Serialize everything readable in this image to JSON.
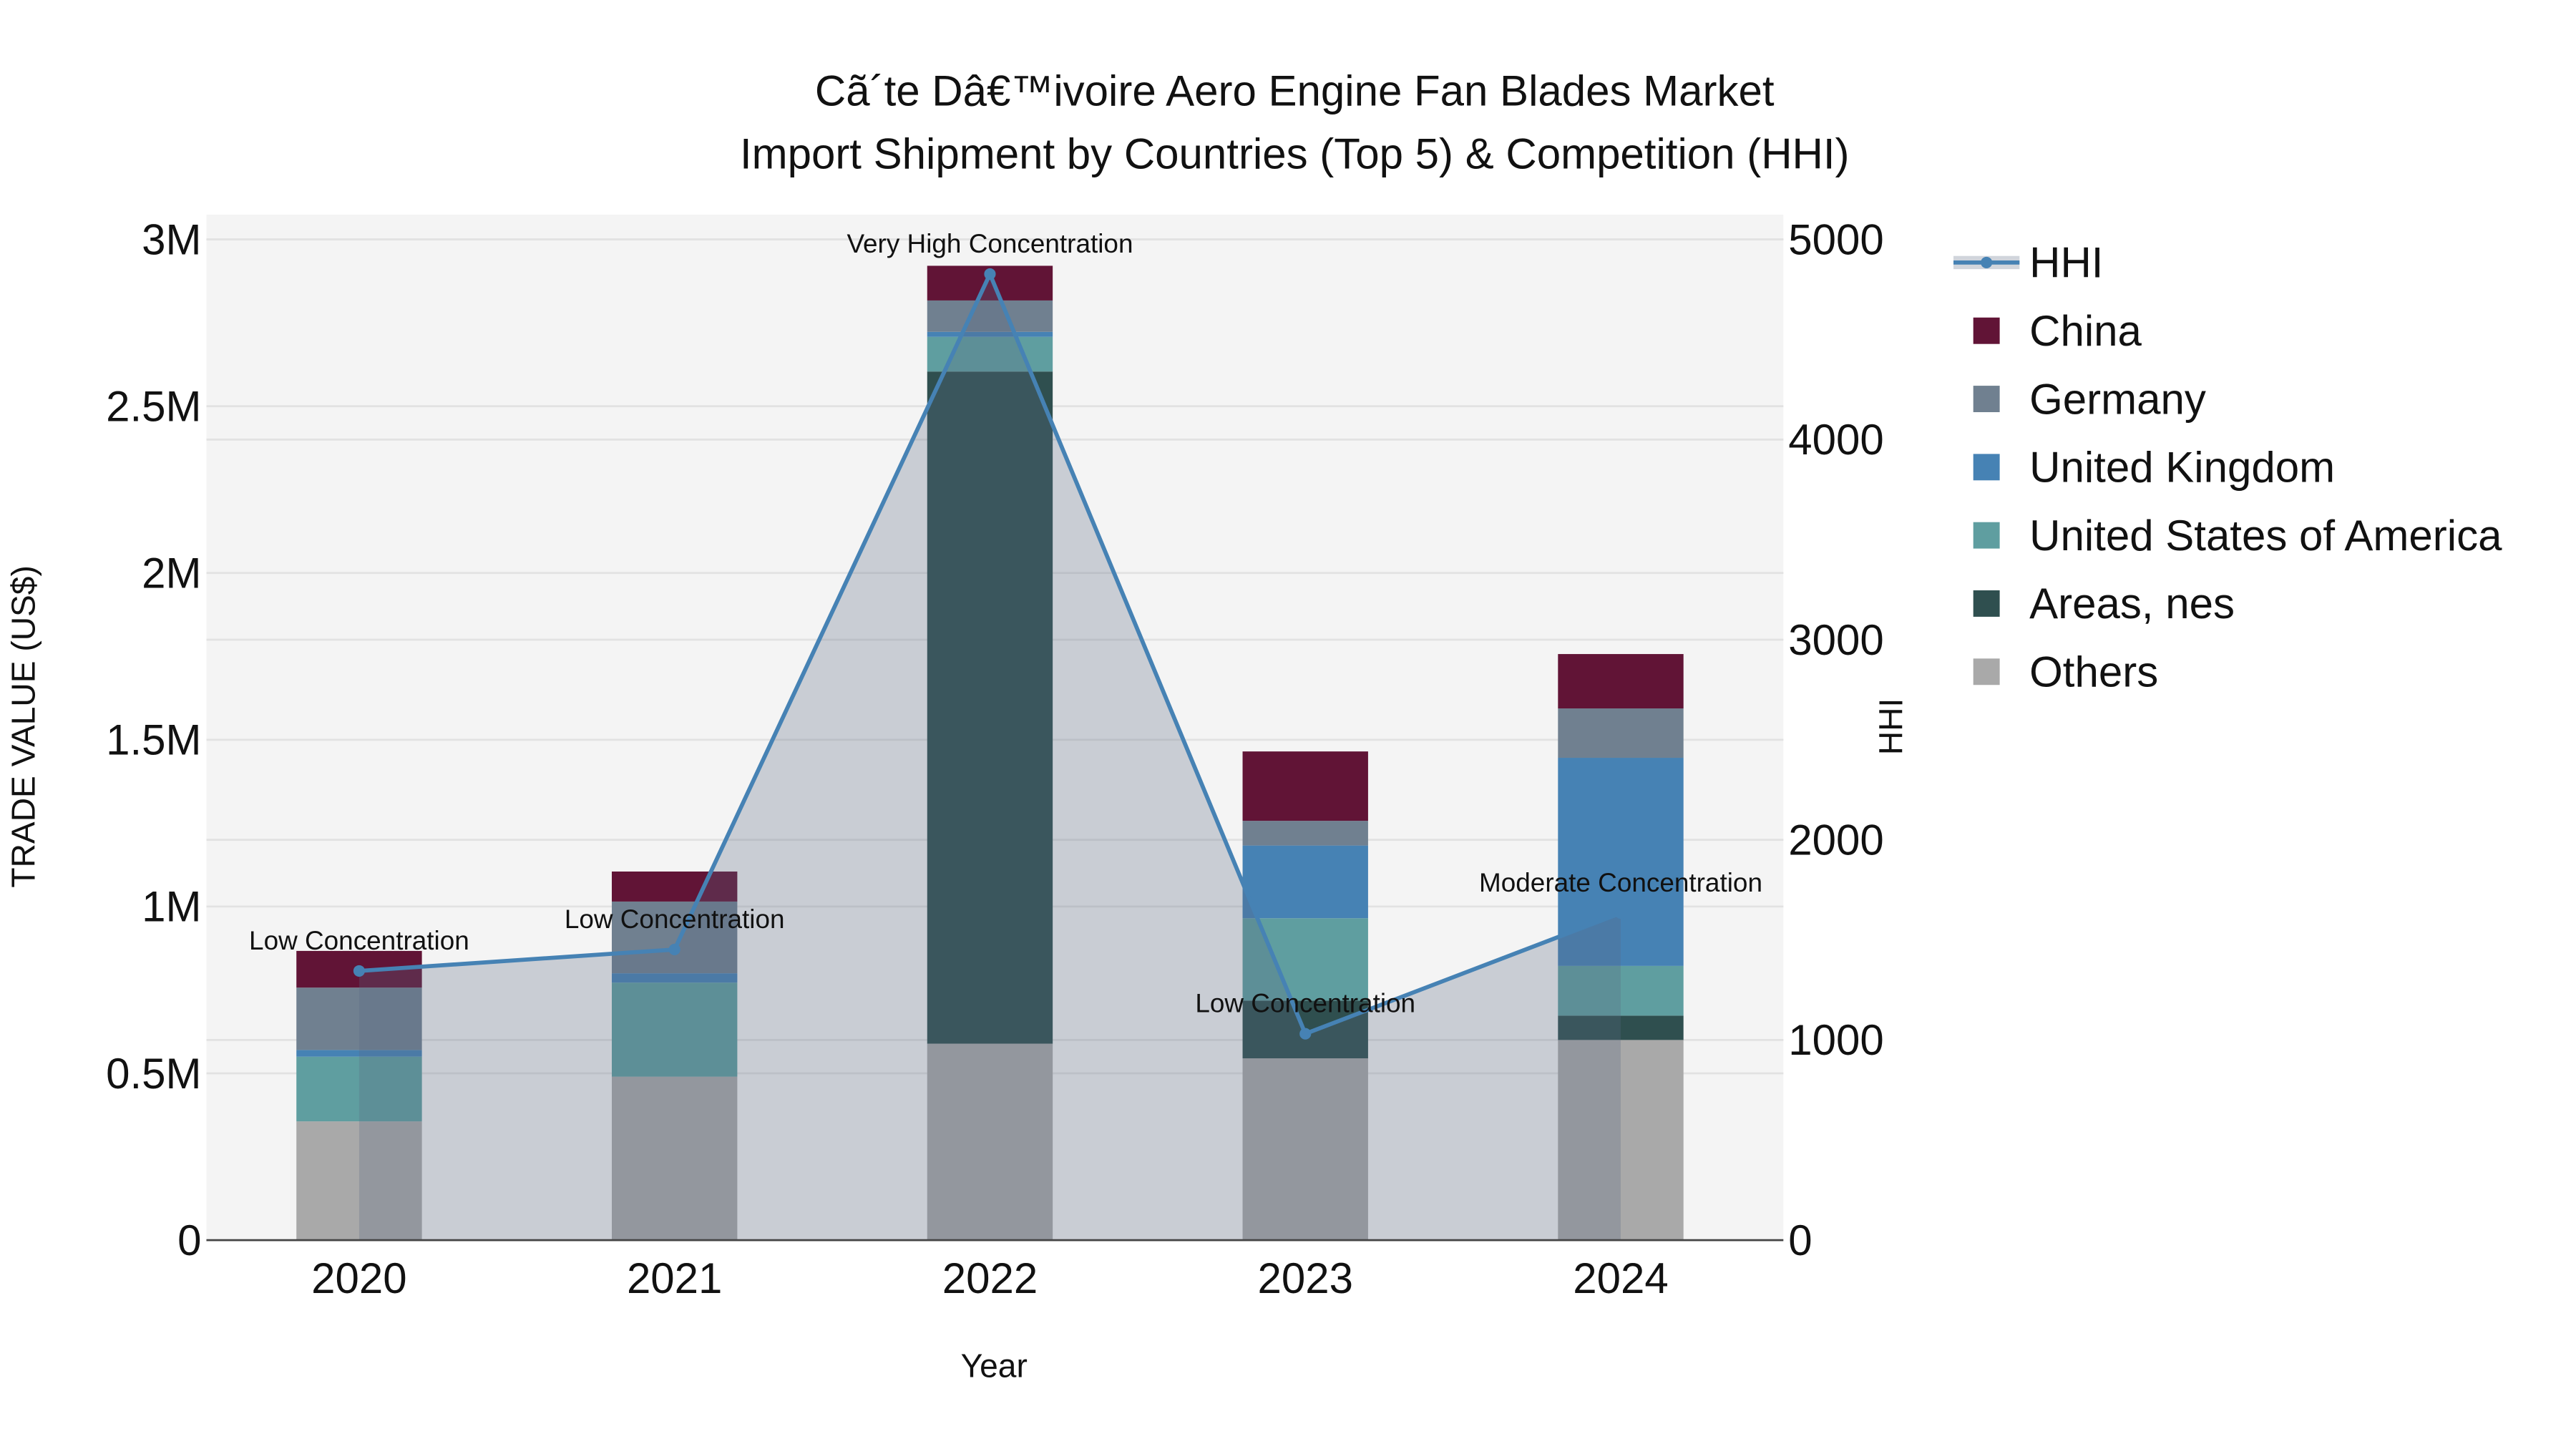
{
  "chart_data": {
    "type": "bar",
    "title": "Cã´te Dâ€™ivoire Aero Engine Fan Blades Market",
    "subtitle": "Import Shipment by Countries (Top 5) & Competition (HHI)",
    "xlabel": "Year",
    "ylabel": "TRADE VALUE (US$)",
    "y2label": "HHI",
    "categories": [
      "2020",
      "2021",
      "2022",
      "2023",
      "2024"
    ],
    "ylim": [
      0,
      3000000
    ],
    "y2lim": [
      0,
      5000
    ],
    "yticks": [
      {
        "v": 0,
        "label": "0"
      },
      {
        "v": 500000,
        "label": "0.5M"
      },
      {
        "v": 1000000,
        "label": "1M"
      },
      {
        "v": 1500000,
        "label": "1.5M"
      },
      {
        "v": 2000000,
        "label": "2M"
      },
      {
        "v": 2500000,
        "label": "2.5M"
      },
      {
        "v": 3000000,
        "label": "3M"
      }
    ],
    "y2ticks": [
      {
        "v": 0,
        "label": "0"
      },
      {
        "v": 1000,
        "label": "1000"
      },
      {
        "v": 2000,
        "label": "2000"
      },
      {
        "v": 3000,
        "label": "3000"
      },
      {
        "v": 4000,
        "label": "4000"
      },
      {
        "v": 5000,
        "label": "5000"
      }
    ],
    "stack_order": [
      "Others",
      "Areas, nes",
      "United States of America",
      "United Kingdom",
      "Germany",
      "China"
    ],
    "series": [
      {
        "name": "China",
        "color": "#611436",
        "values": [
          110000,
          90000,
          104000,
          208000,
          163000
        ]
      },
      {
        "name": "Germany",
        "color": "#708090",
        "values": [
          187000,
          215000,
          94000,
          74000,
          148000
        ]
      },
      {
        "name": "United Kingdom",
        "color": "#4682B4",
        "values": [
          20000,
          28000,
          15000,
          218000,
          624000
        ]
      },
      {
        "name": "United States of America",
        "color": "#5F9EA0",
        "values": [
          194000,
          282000,
          104000,
          247000,
          149000
        ]
      },
      {
        "name": "Areas, nes",
        "color": "#2F4F4F",
        "values": [
          0,
          0,
          2015000,
          173000,
          73000
        ]
      },
      {
        "name": "Others",
        "color": "#A9A9A9",
        "values": [
          356000,
          490000,
          589000,
          545000,
          600000
        ]
      }
    ],
    "hhi": {
      "name": "HHI",
      "color": "#4682B4",
      "values": [
        1345,
        1452,
        4827,
        1031,
        1634
      ],
      "annotations": [
        "Low Concentration",
        "Low Concentration",
        "Very High Concentration",
        "Low Concentration",
        "Moderate Concentration"
      ]
    },
    "legend": [
      "HHI",
      "China",
      "Germany",
      "United Kingdom",
      "United States of America",
      "Areas, nes",
      "Others"
    ],
    "legend_position": "right",
    "grid": true
  }
}
